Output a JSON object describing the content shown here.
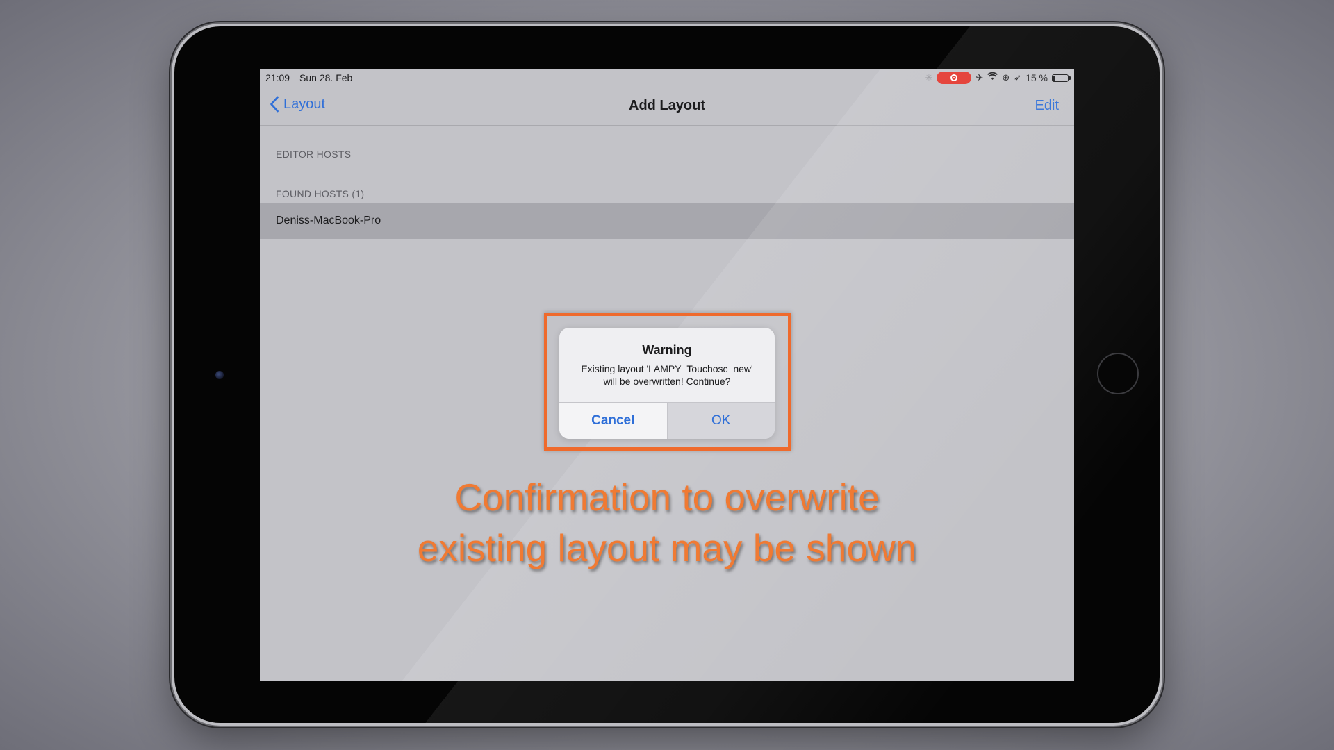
{
  "status_bar": {
    "time": "21:09",
    "date": "Sun 28. Feb",
    "battery": "15 %",
    "icons": [
      "spinner-icon",
      "screen-recording-icon",
      "airplane-icon",
      "wifi-icon",
      "orientation-lock-icon",
      "location-icon",
      "battery-icon"
    ],
    "recording_color": "#e3342b"
  },
  "nav": {
    "back_label": "Layout",
    "title": "Add Layout",
    "edit_label": "Edit"
  },
  "sections": {
    "editor_hosts": "EDITOR HOSTS",
    "found_hosts": "FOUND HOSTS (1)",
    "hosts": [
      "Deniss-MacBook-Pro"
    ]
  },
  "alert": {
    "title": "Warning",
    "message_line1": "Existing layout 'LAMPY_Touchosc_new'",
    "message_line2": "will be overwritten! Continue?",
    "cancel_label": "Cancel",
    "ok_label": "OK"
  },
  "caption": {
    "line1": "Confirmation to overwrite",
    "line2": "existing layout may be shown"
  },
  "colors": {
    "accent_blue": "#2f6fd8",
    "highlight_orange": "#ef6a2c",
    "caption_orange": "#f07a33"
  }
}
